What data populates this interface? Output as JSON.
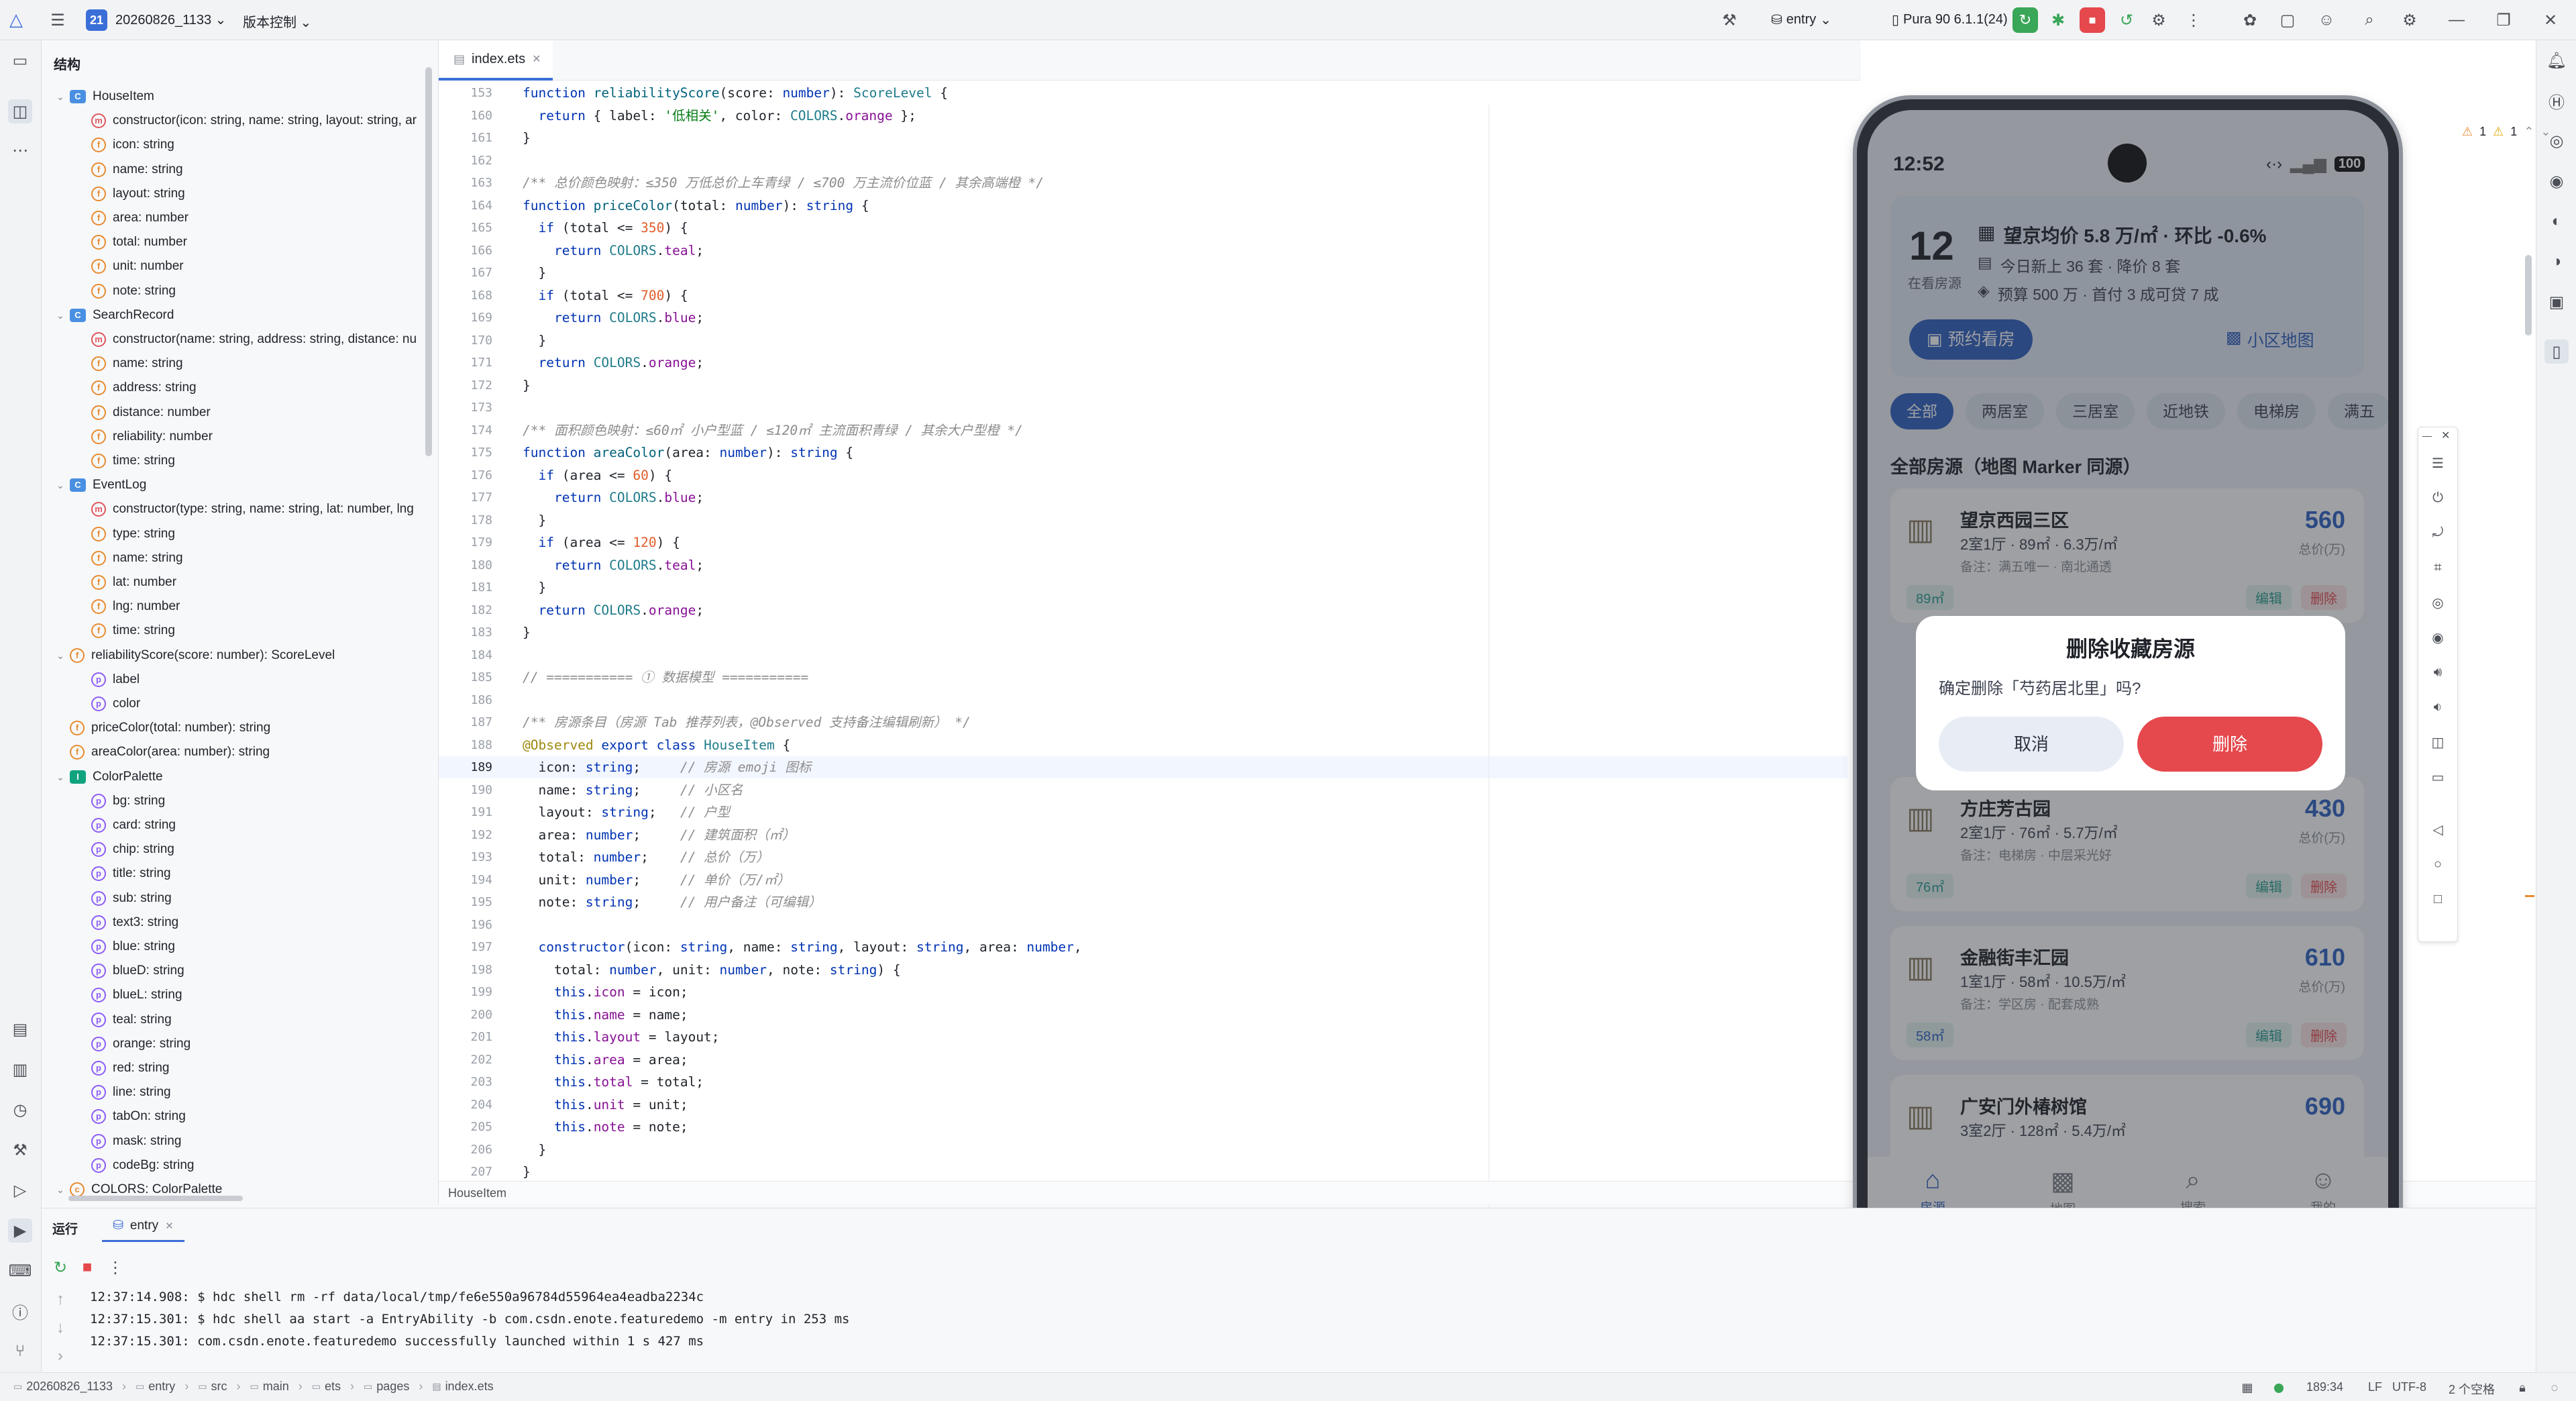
{
  "titlebar": {
    "project_badge": "21",
    "project_name": "20260826_1133",
    "vcs_label": "版本控制",
    "run_config": "entry",
    "device": "Pura 90 6.1.1(24)"
  },
  "structure": {
    "title": "结构",
    "items": [
      {
        "kind": "class",
        "text": "HouseItem",
        "level": 0,
        "arrow": "v"
      },
      {
        "kind": "m",
        "text": "constructor(icon: string, name: string, layout: string, ar",
        "level": 1
      },
      {
        "kind": "f",
        "text": "icon: string",
        "level": 1
      },
      {
        "kind": "f",
        "text": "name: string",
        "level": 1
      },
      {
        "kind": "f",
        "text": "layout: string",
        "level": 1
      },
      {
        "kind": "f",
        "text": "area: number",
        "level": 1
      },
      {
        "kind": "f",
        "text": "total: number",
        "level": 1
      },
      {
        "kind": "f",
        "text": "unit: number",
        "level": 1
      },
      {
        "kind": "f",
        "text": "note: string",
        "level": 1
      },
      {
        "kind": "class",
        "text": "SearchRecord",
        "level": 0,
        "arrow": "v"
      },
      {
        "kind": "m",
        "text": "constructor(name: string, address: string, distance: nu",
        "level": 1
      },
      {
        "kind": "f",
        "text": "name: string",
        "level": 1
      },
      {
        "kind": "f",
        "text": "address: string",
        "level": 1
      },
      {
        "kind": "f",
        "text": "distance: number",
        "level": 1
      },
      {
        "kind": "f",
        "text": "reliability: number",
        "level": 1
      },
      {
        "kind": "f",
        "text": "time: string",
        "level": 1
      },
      {
        "kind": "class",
        "text": "EventLog",
        "level": 0,
        "arrow": "v"
      },
      {
        "kind": "m",
        "text": "constructor(type: string, name: string, lat: number, lng",
        "level": 1
      },
      {
        "kind": "f",
        "text": "type: string",
        "level": 1
      },
      {
        "kind": "f",
        "text": "name: string",
        "level": 1
      },
      {
        "kind": "f",
        "text": "lat: number",
        "level": 1
      },
      {
        "kind": "f",
        "text": "lng: number",
        "level": 1
      },
      {
        "kind": "f",
        "text": "time: string",
        "level": 1
      },
      {
        "kind": "fn",
        "text": "reliabilityScore(score: number): ScoreLevel",
        "level": 0,
        "arrow": "v"
      },
      {
        "kind": "p",
        "text": "label",
        "level": 1
      },
      {
        "kind": "p",
        "text": "color",
        "level": 1
      },
      {
        "kind": "fn",
        "text": "priceColor(total: number): string",
        "level": 0
      },
      {
        "kind": "fn",
        "text": "areaColor(area: number): string",
        "level": 0
      },
      {
        "kind": "iface",
        "text": "ColorPalette",
        "level": 0,
        "arrow": "v"
      },
      {
        "kind": "p",
        "text": "bg: string",
        "level": 1
      },
      {
        "kind": "p",
        "text": "card: string",
        "level": 1
      },
      {
        "kind": "p",
        "text": "chip: string",
        "level": 1
      },
      {
        "kind": "p",
        "text": "title: string",
        "level": 1
      },
      {
        "kind": "p",
        "text": "sub: string",
        "level": 1
      },
      {
        "kind": "p",
        "text": "text3: string",
        "level": 1
      },
      {
        "kind": "p",
        "text": "blue: string",
        "level": 1
      },
      {
        "kind": "p",
        "text": "blueD: string",
        "level": 1
      },
      {
        "kind": "p",
        "text": "blueL: string",
        "level": 1
      },
      {
        "kind": "p",
        "text": "teal: string",
        "level": 1
      },
      {
        "kind": "p",
        "text": "orange: string",
        "level": 1
      },
      {
        "kind": "p",
        "text": "red: string",
        "level": 1
      },
      {
        "kind": "p",
        "text": "line: string",
        "level": 1
      },
      {
        "kind": "p",
        "text": "tabOn: string",
        "level": 1
      },
      {
        "kind": "p",
        "text": "mask: string",
        "level": 1
      },
      {
        "kind": "p",
        "text": "codeBg: string",
        "level": 1
      },
      {
        "kind": "const",
        "text": "COLORS: ColorPalette",
        "level": 0,
        "arrow": "v"
      }
    ]
  },
  "editor": {
    "tab": "index.ets",
    "breadcrumb": "HouseItem",
    "warnings": "1",
    "weak_warnings": "1",
    "lines": [
      {
        "n": "153",
        "t": "function reliabilityScore(score: number): ScoreLevel {"
      },
      {
        "n": "160",
        "t": "  return { label: '低相关', color: COLORS.orange };"
      },
      {
        "n": "161",
        "t": "}"
      },
      {
        "n": "162",
        "t": ""
      },
      {
        "n": "163",
        "t": "/** 总价颜色映射：≤350 万低总价上车青绿 / ≤700 万主流价位蓝 / 其余高端橙 */"
      },
      {
        "n": "164",
        "t": "function priceColor(total: number): string {"
      },
      {
        "n": "165",
        "t": "  if (total <= 350) {"
      },
      {
        "n": "166",
        "t": "    return COLORS.teal;"
      },
      {
        "n": "167",
        "t": "  }"
      },
      {
        "n": "168",
        "t": "  if (total <= 700) {"
      },
      {
        "n": "169",
        "t": "    return COLORS.blue;"
      },
      {
        "n": "170",
        "t": "  }"
      },
      {
        "n": "171",
        "t": "  return COLORS.orange;"
      },
      {
        "n": "172",
        "t": "}"
      },
      {
        "n": "173",
        "t": ""
      },
      {
        "n": "174",
        "t": "/** 面积颜色映射：≤60㎡ 小户型蓝 / ≤120㎡ 主流面积青绿 / 其余大户型橙 */"
      },
      {
        "n": "175",
        "t": "function areaColor(area: number): string {"
      },
      {
        "n": "176",
        "t": "  if (area <= 60) {"
      },
      {
        "n": "177",
        "t": "    return COLORS.blue;"
      },
      {
        "n": "178",
        "t": "  }"
      },
      {
        "n": "179",
        "t": "  if (area <= 120) {"
      },
      {
        "n": "180",
        "t": "    return COLORS.teal;"
      },
      {
        "n": "181",
        "t": "  }"
      },
      {
        "n": "182",
        "t": "  return COLORS.orange;"
      },
      {
        "n": "183",
        "t": "}"
      },
      {
        "n": "184",
        "t": ""
      },
      {
        "n": "185",
        "t": "// =========== ① 数据模型 ==========="
      },
      {
        "n": "186",
        "t": ""
      },
      {
        "n": "187",
        "t": "/** 房源条目（房源 Tab 推荐列表，@Observed 支持备注编辑刷新） */"
      },
      {
        "n": "188",
        "t": "@Observed export class HouseItem {"
      },
      {
        "n": "189",
        "t": "  icon: string;     // 房源 emoji 图标"
      },
      {
        "n": "190",
        "t": "  name: string;     // 小区名"
      },
      {
        "n": "191",
        "t": "  layout: string;   // 户型"
      },
      {
        "n": "192",
        "t": "  area: number;     // 建筑面积（㎡）"
      },
      {
        "n": "193",
        "t": "  total: number;    // 总价（万）"
      },
      {
        "n": "194",
        "t": "  unit: number;     // 单价（万/㎡）"
      },
      {
        "n": "195",
        "t": "  note: string;     // 用户备注（可编辑）"
      },
      {
        "n": "196",
        "t": ""
      },
      {
        "n": "197",
        "t": "  constructor(icon: string, name: string, layout: string, area: number,"
      },
      {
        "n": "198",
        "t": "    total: number, unit: number, note: string) {"
      },
      {
        "n": "199",
        "t": "    this.icon = icon;"
      },
      {
        "n": "200",
        "t": "    this.name = name;"
      },
      {
        "n": "201",
        "t": "    this.layout = layout;"
      },
      {
        "n": "202",
        "t": "    this.area = area;"
      },
      {
        "n": "203",
        "t": "    this.total = total;"
      },
      {
        "n": "204",
        "t": "    this.unit = unit;"
      },
      {
        "n": "205",
        "t": "    this.note = note;"
      },
      {
        "n": "206",
        "t": "  }"
      },
      {
        "n": "207",
        "t": "}"
      },
      {
        "n": "208",
        "t": ""
      }
    ]
  },
  "run_panel": {
    "label": "运行",
    "tab": "entry",
    "logs": [
      "12:37:14.908: $ hdc shell rm -rf data/local/tmp/fe6e550a96784d55964ea4eadba2234c",
      "12:37:15.301: $ hdc shell aa start -a EntryAbility -b com.csdn.enote.featuredemo -m entry in 253 ms",
      "12:37:15.301: com.csdn.enote.featuredemo successfully launched within 1 s 427 ms"
    ]
  },
  "statusbar": {
    "crumbs": [
      "20260826_1133",
      "entry",
      "src",
      "main",
      "ets",
      "pages",
      "index.ets"
    ],
    "position": "189:34",
    "line_sep": "LF",
    "encoding": "UTF-8",
    "indent": "2 个空格"
  },
  "phone": {
    "time": "12:52",
    "battery": "100",
    "summary": {
      "count": "12",
      "count_label": "在看房源",
      "headline": "望京均价 5.8 万/㎡ · 环比 -0.6%",
      "line2": "今日新上 36 套 · 降价 8 套",
      "line3": "预算 500 万 · 首付 3 成可贷 7 成",
      "book_btn": "预约看房",
      "map_btn": "小区地图"
    },
    "chips": [
      "全部",
      "两居室",
      "三居室",
      "近地铁",
      "电梯房",
      "满五"
    ],
    "section_title": "全部房源（地图 Marker 同源）",
    "houses": [
      {
        "name": "望京西园三区",
        "info": "2室1厅 · 89㎡ · 6.3万/㎡",
        "note": "备注：满五唯一 · 南北通透",
        "area_tag": "89㎡",
        "price": "560",
        "price_unit": "总价(万)"
      },
      {
        "name": "方庄芳古园",
        "info": "2室1厅 · 76㎡ · 5.7万/㎡",
        "note": "备注：电梯房 · 中层采光好",
        "area_tag": "76㎡",
        "price": "430",
        "price_unit": "总价(万)"
      },
      {
        "name": "金融街丰汇园",
        "info": "1室1厅 · 58㎡ · 10.5万/㎡",
        "note": "备注：学区房 · 配套成熟",
        "area_tag": "58㎡",
        "price": "610",
        "price_unit": "总价(万)"
      },
      {
        "name": "广安门外椿树馆",
        "info": "3室2厅 · 128㎡ · 5.4万/㎡",
        "note": "",
        "area_tag": "",
        "price": "690",
        "price_unit": ""
      }
    ],
    "edit_label": "编辑",
    "delete_label": "删除",
    "dialog": {
      "title": "删除收藏房源",
      "message": "确定删除「芍药居北里」吗?",
      "cancel": "取消",
      "confirm": "删除"
    },
    "nav": [
      "房源",
      "地图",
      "搜索",
      "我的"
    ]
  },
  "colors": {
    "accent_blue": "#2f5fbf",
    "danger_red": "#e5484d",
    "teal": "#2a9d8f",
    "price_blue": "#2f62c4"
  }
}
